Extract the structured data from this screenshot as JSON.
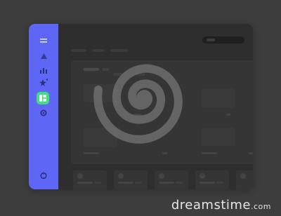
{
  "sidebar": {
    "icons": [
      "menu-icon",
      "triangle-icon",
      "bar-chart-icon",
      "sparkle-icon",
      "dashboard-icon",
      "settings-icon",
      "logout-icon"
    ],
    "active": "dashboard-icon",
    "accent": "#5e66f6",
    "active_color": "#3ee07b"
  },
  "watermark": {
    "text": "dreamstime",
    "suffix": ".com"
  }
}
